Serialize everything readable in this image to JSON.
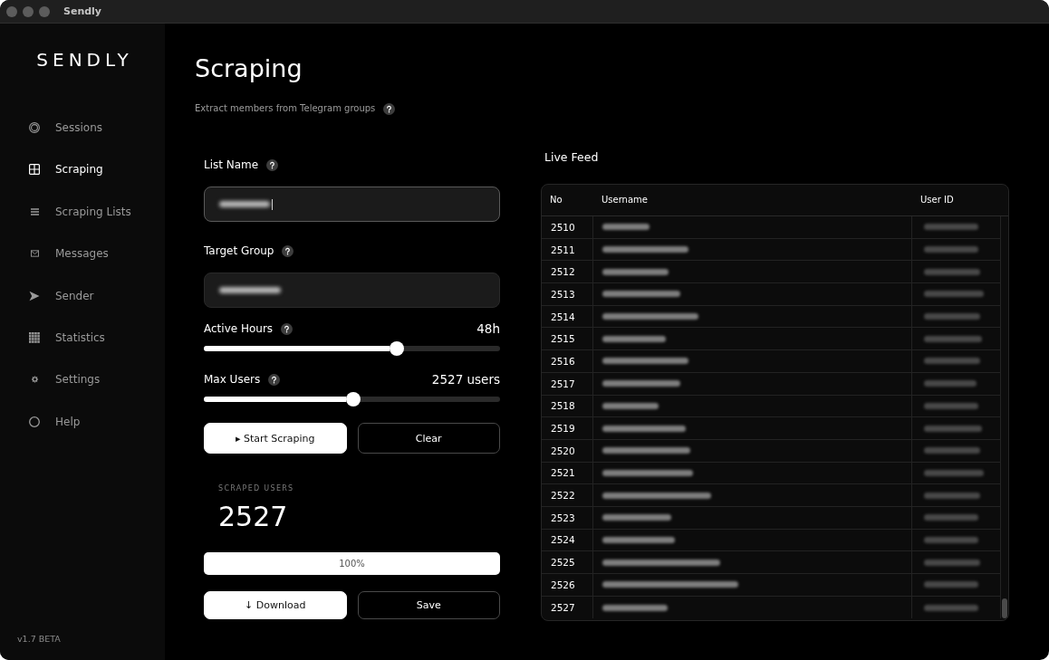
{
  "window": {
    "title": "Sendly"
  },
  "sidebar": {
    "logo": "SENDLY",
    "items": [
      {
        "label": "Sessions",
        "selected": false
      },
      {
        "label": "Scraping",
        "selected": true
      },
      {
        "label": "Scraping Lists",
        "selected": false
      },
      {
        "label": "Messages",
        "selected": false
      },
      {
        "label": "Sender",
        "selected": false
      },
      {
        "label": "Statistics",
        "selected": false
      },
      {
        "label": "Settings",
        "selected": false
      },
      {
        "label": "Help",
        "selected": false
      }
    ],
    "version": "v1.7 BETA"
  },
  "page": {
    "title": "Scraping",
    "subtitle": "Extract members from Telegram groups"
  },
  "form": {
    "fields": [
      {
        "label": "List Name",
        "focused": true
      },
      {
        "label": "Target Group",
        "focused": false
      }
    ],
    "sliders": [
      {
        "label": "Active Hours",
        "reading": "48h",
        "level": 0.65
      },
      {
        "label": "Max Users",
        "reading": "2527 users",
        "level": 0.505
      }
    ],
    "actions": [
      {
        "label": "▸ Start Scraping",
        "kind": "primary"
      },
      {
        "label": "Clear",
        "kind": "secondary"
      }
    ]
  },
  "stats": {
    "label": "SCRAPED USERS",
    "value": "2527"
  },
  "progress": {
    "level": 1,
    "reading": "100%"
  },
  "export_actions": [
    {
      "label": "↓ Download",
      "kind": "primary"
    },
    {
      "label": "Save",
      "kind": "secondary"
    }
  ],
  "live_feed": {
    "title": "Live Feed",
    "columns": [
      "No",
      "Username",
      "User ID"
    ],
    "rows": [
      {
        "no": "2510"
      },
      {
        "no": "2511"
      },
      {
        "no": "2512"
      },
      {
        "no": "2513"
      },
      {
        "no": "2514"
      },
      {
        "no": "2515"
      },
      {
        "no": "2516"
      },
      {
        "no": "2517"
      },
      {
        "no": "2518"
      },
      {
        "no": "2519"
      },
      {
        "no": "2520"
      },
      {
        "no": "2521"
      },
      {
        "no": "2522"
      },
      {
        "no": "2523"
      },
      {
        "no": "2524"
      },
      {
        "no": "2525"
      },
      {
        "no": "2526"
      },
      {
        "no": "2527"
      }
    ]
  }
}
